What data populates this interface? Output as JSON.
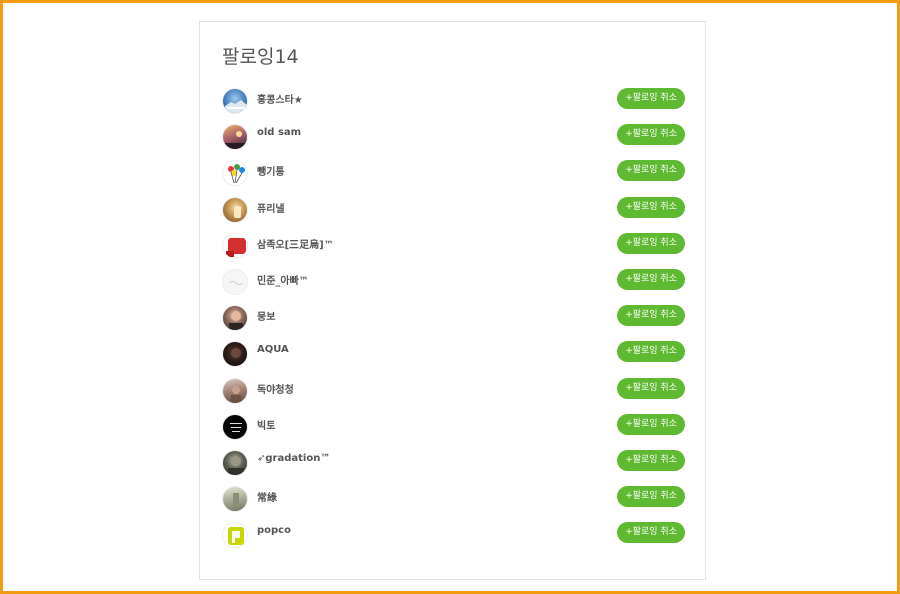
{
  "page": {
    "title": "팔로잉14"
  },
  "colors": {
    "frame": "#f39c12",
    "button": "#5fb931"
  },
  "following": [
    {
      "name": "홍콩스타★",
      "button": "+팔로잉 취소"
    },
    {
      "name": "old sam",
      "button": "+팔로잉 취소"
    },
    {
      "name": "뺑기통",
      "button": "+팔로잉 취소"
    },
    {
      "name": "퓨리낼",
      "button": "+팔로잉 취소"
    },
    {
      "name": "삼족오[三足烏]™",
      "button": "+팔로잉 취소"
    },
    {
      "name": "민준_아빠™",
      "button": "+팔로잉 취소"
    },
    {
      "name": "뭉보",
      "button": "+팔로잉 취소"
    },
    {
      "name": "AQUA",
      "button": "+팔로잉 취소"
    },
    {
      "name": "독야청청",
      "button": "+팔로잉 취소"
    },
    {
      "name": "빅토",
      "button": "+팔로잉 취소"
    },
    {
      "name": "➶gradation™",
      "button": "+팔로잉 취소"
    },
    {
      "name": "常綠",
      "button": "+팔로잉 취소"
    },
    {
      "name": "popco",
      "button": "+팔로잉 취소"
    }
  ]
}
